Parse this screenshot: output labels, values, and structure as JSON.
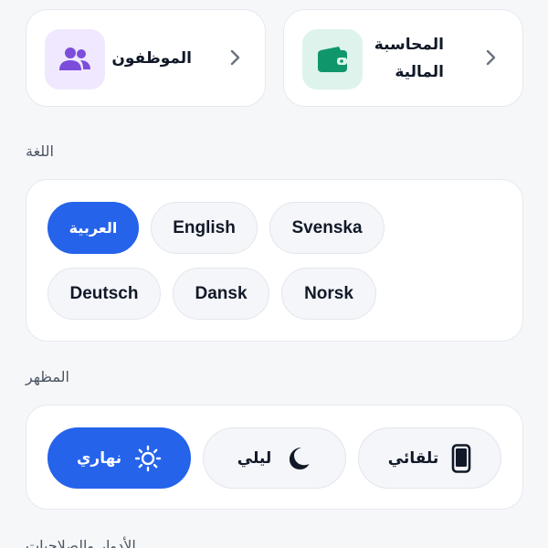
{
  "top_cards": {
    "employees": {
      "label": "الموظفون",
      "icon": "users-icon"
    },
    "accounting": {
      "label": "المحاسبة المالية",
      "icon": "wallet-icon"
    }
  },
  "language": {
    "section_label": "اللغة",
    "options": [
      {
        "label": "العربية",
        "selected": true
      },
      {
        "label": "English",
        "selected": false
      },
      {
        "label": "Svenska",
        "selected": false
      },
      {
        "label": "Deutsch",
        "selected": false
      },
      {
        "label": "Dansk",
        "selected": false
      },
      {
        "label": "Norsk",
        "selected": false
      }
    ]
  },
  "appearance": {
    "section_label": "المظهر",
    "options": [
      {
        "label": "نهاري",
        "icon": "sun-icon",
        "selected": true
      },
      {
        "label": "ليلي",
        "icon": "moon-icon",
        "selected": false
      },
      {
        "label": "تلقائي",
        "icon": "phone-icon",
        "selected": false
      }
    ]
  },
  "next_section_label": "الأدوار والصلاحيات",
  "colors": {
    "accent": "#2563eb",
    "employees_tile": "#efe8ff",
    "employees_icon": "#7c4ddb",
    "accounting_tile": "#def3ec",
    "accounting_icon": "#10966b"
  }
}
